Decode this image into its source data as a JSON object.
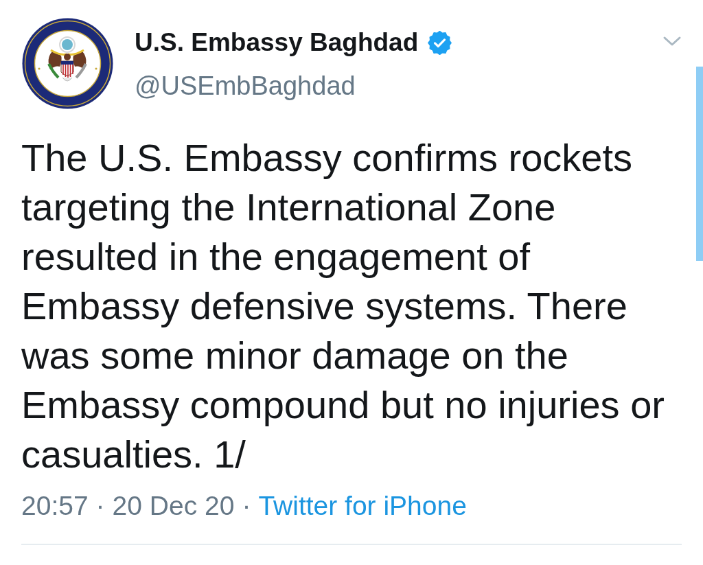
{
  "tweet": {
    "author": {
      "name": "U.S. Embassy Baghdad",
      "verified": true,
      "handle": "@USEmbBaghdad"
    },
    "text": "The U.S. Embassy confirms rockets targeting the International Zone resulted in the engagement of Embassy defensive systems. There was some minor damage on the Embassy compound but no injuries or casualties. 1/",
    "meta": [
      {
        "kind": "time",
        "text": "20:57"
      },
      {
        "kind": "separator",
        "text": "·"
      },
      {
        "kind": "date",
        "text": "20 Dec 20"
      },
      {
        "kind": "separator",
        "text": "·"
      },
      {
        "kind": "link",
        "text": "Twitter for iPhone"
      }
    ]
  }
}
